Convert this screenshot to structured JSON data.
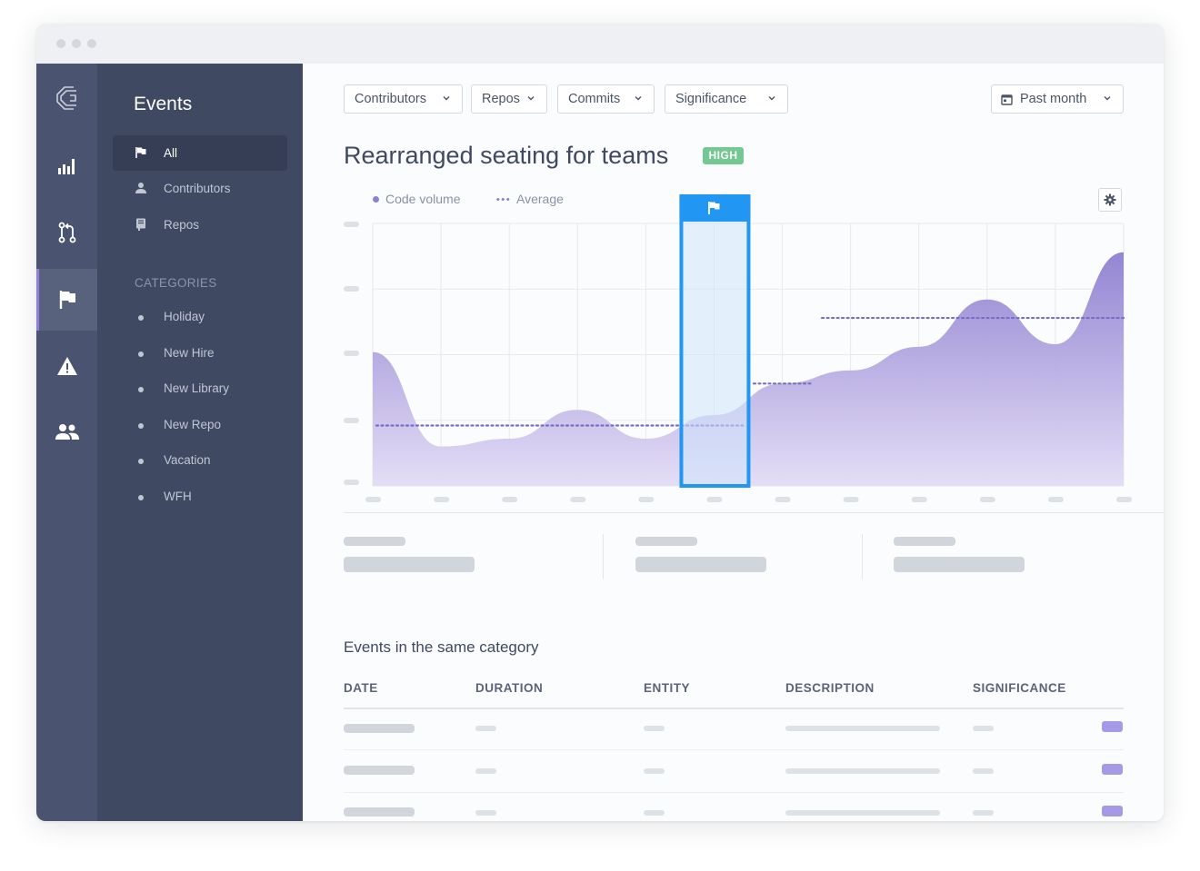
{
  "sidebar": {
    "title": "Events",
    "nav": [
      {
        "label": "All",
        "icon": "flag-icon"
      },
      {
        "label": "Contributors",
        "icon": "person-icon"
      },
      {
        "label": "Repos",
        "icon": "repo-book-icon"
      }
    ],
    "categories_title": "CATEGORIES",
    "categories": [
      "Holiday",
      "New Hire",
      "New Library",
      "New Repo",
      "Vacation",
      "WFH"
    ]
  },
  "rail": {
    "icons": [
      "logo-icon",
      "bar-chart-icon",
      "pull-request-icon",
      "flag-icon",
      "warning-icon",
      "people-icon"
    ],
    "active": "flag-icon"
  },
  "filters": {
    "contributors": "Contributors",
    "repos": "Repos",
    "commits": "Commits",
    "significance": "Significance",
    "date_range": "Past month"
  },
  "event": {
    "title": "Rearranged seating for teams",
    "badge": "HIGH"
  },
  "legend": {
    "series": "Code volume",
    "average": "Average"
  },
  "colors": {
    "accent": "#8f7fd9",
    "badge_high": "#74c892",
    "highlight": "#2196f3",
    "sidebar": "#3f4962"
  },
  "chart_data": {
    "type": "area",
    "x": [
      0,
      1,
      2,
      3,
      4,
      5,
      6,
      7,
      8,
      9,
      10,
      11
    ],
    "series": [
      {
        "name": "Code volume",
        "values": [
          0.51,
          0.15,
          0.18,
          0.29,
          0.18,
          0.27,
          0.39,
          0.44,
          0.53,
          0.71,
          0.54,
          0.89
        ]
      },
      {
        "name": "Average",
        "values": [
          0.23,
          0.23,
          0.23,
          0.23,
          0.23,
          0.23,
          0.39,
          0.64,
          0.64,
          0.64,
          0.64,
          0.64
        ]
      }
    ],
    "highlight_index": 5,
    "ylim": [
      0,
      1
    ],
    "grid": true,
    "legend": "top-left"
  },
  "table": {
    "title": "Events in the same category",
    "columns": [
      "DATE",
      "DURATION",
      "ENTITY",
      "DESCRIPTION",
      "SIGNIFICANCE"
    ]
  }
}
